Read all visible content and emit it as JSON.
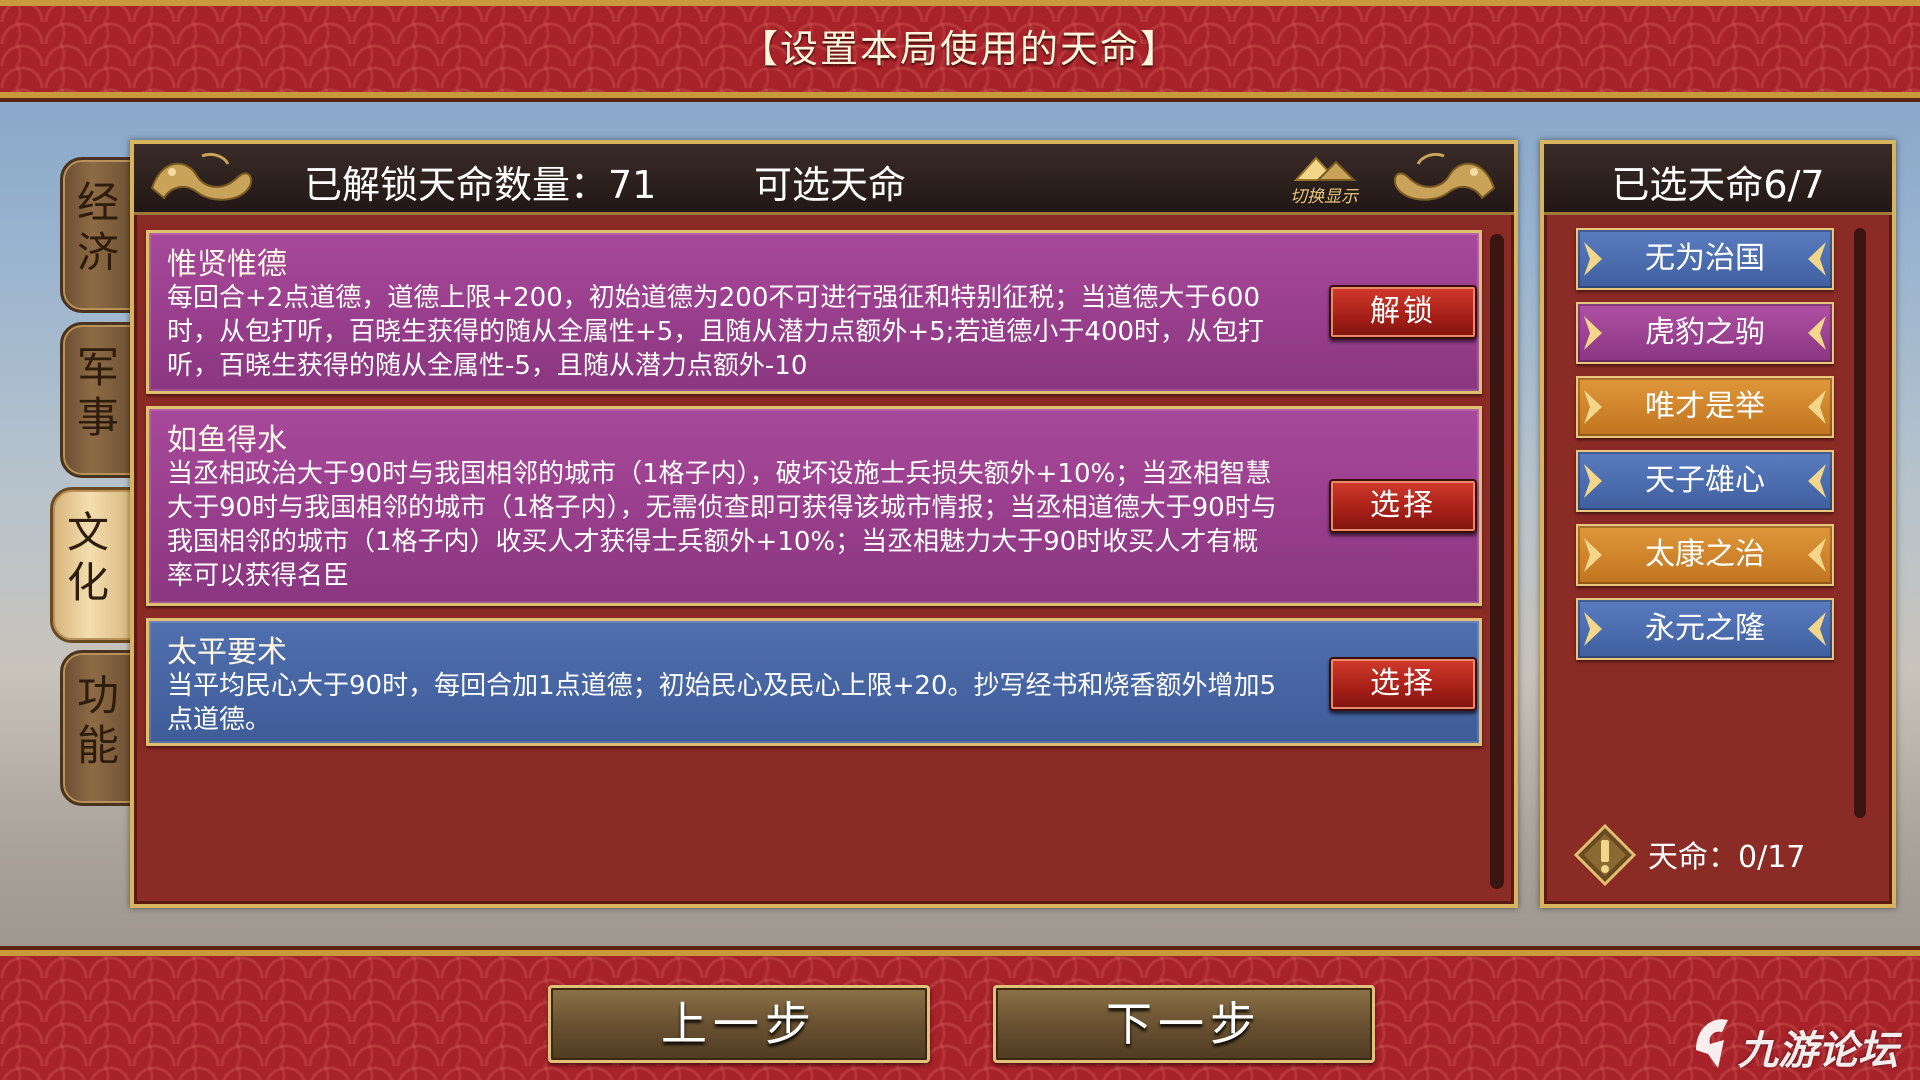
{
  "header": {
    "title": "【设置本局使用的天命】"
  },
  "side_tabs": [
    {
      "label": "经济",
      "active": false
    },
    {
      "label": "军事",
      "active": false
    },
    {
      "label": "文化",
      "active": true
    },
    {
      "label": "功能",
      "active": false
    }
  ],
  "main": {
    "unlocked_count_label": "已解锁天命数量：71",
    "available_title": "可选天命",
    "switch_label": "切换显示",
    "cards": [
      {
        "name": "惟贤惟德",
        "color": "purple",
        "description": "每回合+2点道德，道德上限+200，初始道德为200不可进行强征和特别征税；当道德大于600时，从包打听，百晓生获得的随从全属性+5，且随从潜力点额外+5;若道德小于400时，从包打听，百晓生获得的随从全属性-5，且随从潜力点额外-10",
        "button_label": "解锁"
      },
      {
        "name": "如鱼得水",
        "color": "purple",
        "description": "当丞相政治大于90时与我国相邻的城市（1格子内），破坏设施士兵损失额外+10%；当丞相智慧大于90时与我国相邻的城市（1格子内），无需侦查即可获得该城市情报；当丞相道德大于90时与我国相邻的城市（1格子内）收买人才获得士兵额外+10%；当丞相魅力大于90时收买人才有概率可以获得名臣",
        "button_label": "选择"
      },
      {
        "name": "太平要术",
        "color": "blue",
        "description": "当平均民心大于90时，每回合加1点道德；初始民心及民心上限+20。抄写经书和烧香额外增加5点道德。",
        "button_label": "选择"
      }
    ]
  },
  "right": {
    "title": "已选天命6/7",
    "chosen": [
      {
        "label": "无为治国",
        "color": "blue"
      },
      {
        "label": "虎豹之驹",
        "color": "purple"
      },
      {
        "label": "唯才是举",
        "color": "orange"
      },
      {
        "label": "天子雄心",
        "color": "blue"
      },
      {
        "label": "太康之治",
        "color": "orange"
      },
      {
        "label": "永元之隆",
        "color": "blue"
      }
    ],
    "fate_count": "天命：0/17"
  },
  "footer": {
    "prev_label": "上一步",
    "next_label": "下一步"
  },
  "watermark": {
    "text": "九游论坛"
  },
  "colors": {
    "banner_red": "#a8222a",
    "panel_red": "#8b2b26",
    "gold": "#d9b45e",
    "purple": "#a8489a",
    "blue": "#4f6fae",
    "orange": "#e0973a",
    "button_red": "#d23a2c"
  }
}
